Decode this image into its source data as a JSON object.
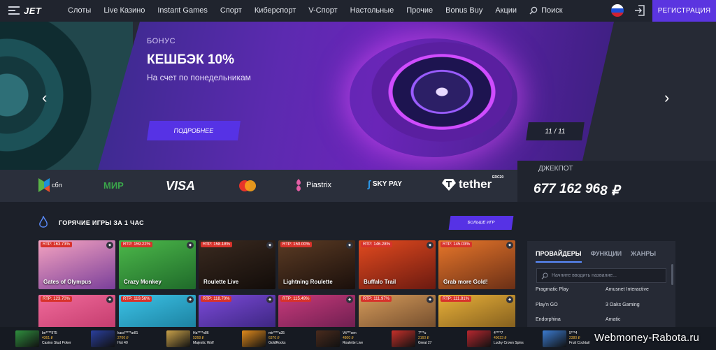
{
  "header": {
    "logo": "JET",
    "nav": [
      "Слоты",
      "Live Казино",
      "Instant Games",
      "Спорт",
      "Киберспорт",
      "V-Спорт",
      "Настольные",
      "Прочие",
      "Bonus Buy",
      "Акции"
    ],
    "search_label": "Поиск",
    "register_label": "РЕГИСТРАЦИЯ"
  },
  "hero": {
    "kicker": "БОНУС",
    "title": "КЕШБЭК 10%",
    "subtitle": "На счет по понедельникам",
    "button": "ПОДРОБНЕЕ",
    "slide_counter": "11 / 11"
  },
  "payments": {
    "sbp": "сбп",
    "mir": "МИР",
    "visa": "VISA",
    "piastrix": "Piastrix",
    "skypay": "SKY PAY",
    "tether": "tether",
    "tether_tag": "ERC20"
  },
  "jackpot": {
    "label": "ДЖЕКПОТ",
    "value": "677 162 96",
    "tail": "8 ₽"
  },
  "hot_games": {
    "title": "ГОРЯЧИЕ ИГРЫ ЗА 1 ЧАС",
    "more_button": "БОЛЬШЕ ИГР",
    "games": [
      {
        "rtp": "RTP: 163.73%",
        "name": "Gates of Olympus",
        "c1": "#f5a3c0",
        "c2": "#7a3f9a"
      },
      {
        "rtp": "RTP: 159.22%",
        "name": "Crazy Monkey",
        "c1": "#4cb84a",
        "c2": "#1f6a2a"
      },
      {
        "rtp": "RTP: 158.18%",
        "name": "Roulette Live",
        "c1": "#3a2a20",
        "c2": "#120c09"
      },
      {
        "rtp": "RTP: 150.00%",
        "name": "Lightning Roulette",
        "c1": "#5b3b24",
        "c2": "#1a0f0b"
      },
      {
        "rtp": "RTP: 146.28%",
        "name": "Buffalo Trail",
        "c1": "#e24a1f",
        "c2": "#6b1a10"
      },
      {
        "rtp": "RTP: 145.03%",
        "name": "Grab more Gold!",
        "c1": "#e7762a",
        "c2": "#6a2f16"
      },
      {
        "rtp": "RTP: 123.70%",
        "name": "",
        "c1": "#f06a9a",
        "c2": "#b93163"
      },
      {
        "rtp": "RTP: 119.56%",
        "name": "",
        "c1": "#3cc2e6",
        "c2": "#14718f"
      },
      {
        "rtp": "RTP: 118.70%",
        "name": "",
        "c1": "#7c4ad8",
        "c2": "#2c1d6b"
      },
      {
        "rtp": "RTP: 115.49%",
        "name": "",
        "c1": "#c63a7a",
        "c2": "#591846"
      },
      {
        "rtp": "RTP: 111.97%",
        "name": "",
        "c1": "#d49a5a",
        "c2": "#5b3a22"
      },
      {
        "rtp": "RTP: 111.81%",
        "name": "",
        "c1": "#e8b039",
        "c2": "#6a4a17"
      }
    ]
  },
  "providers": {
    "tabs": [
      "ПРОВАЙДЕРЫ",
      "ФУНКЦИИ",
      "ЖАНРЫ"
    ],
    "search_placeholder": "Начните вводить название...",
    "items": [
      "Pragmatic Play",
      "Amusnet Interactive",
      "Play'n GO",
      "3 Oaks Gaming",
      "Endorphina",
      "Amatic"
    ]
  },
  "ticker": [
    {
      "user": "be****975",
      "amount": "4361 ₽",
      "game": "Casino Stud Poker",
      "c": "#2f8f3e"
    },
    {
      "user": "kara*****ar81",
      "amount": "2700 ₽",
      "game": "Hot 40",
      "c": "#2a3f9e"
    },
    {
      "user": "Ha****n86",
      "amount": "5268 ₽",
      "game": "Majestic Wolf",
      "c": "#c9a24a"
    },
    {
      "user": "mir****a35",
      "amount": "6370 ₽",
      "game": "GoldRocks",
      "c": "#e08a1c"
    },
    {
      "user": "Vit***sen",
      "amount": "4800 ₽",
      "game": "Roulette Live",
      "c": "#4a2b1d"
    },
    {
      "user": "7***u",
      "amount": "2160 ₽",
      "game": "Great 27",
      "c": "#c7302a"
    },
    {
      "user": "4****7",
      "amount": "40023 ₽",
      "game": "Lucky Crown Spins",
      "c": "#b8272f"
    },
    {
      "user": "5***4",
      "amount": "2380 ₽",
      "game": "Fruit Cocktail",
      "c": "#3b7bd0"
    }
  ],
  "watermark": "Webmoney-Rabota.ru"
}
